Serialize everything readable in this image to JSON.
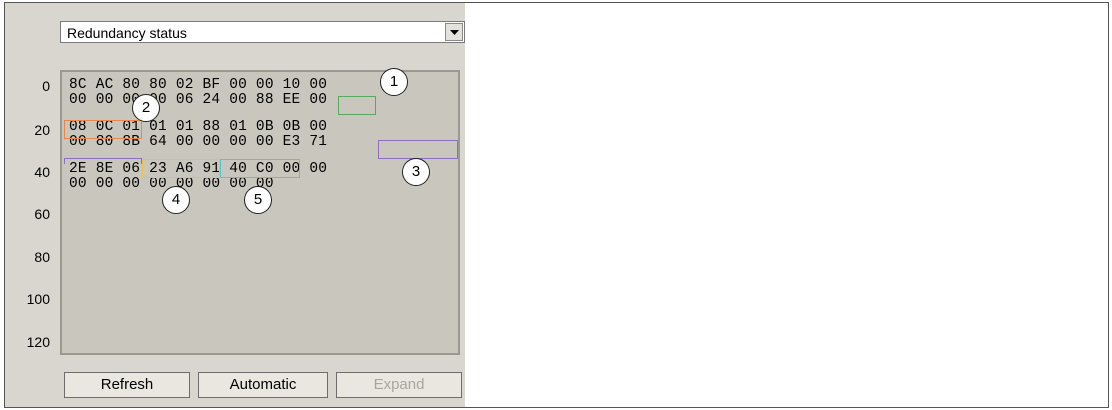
{
  "combo": {
    "selected": "Redundancy status"
  },
  "row_labels": [
    "0",
    "20",
    "40",
    "60",
    "80",
    "100",
    "120"
  ],
  "hex_lines": [
    "8C AC 80 80 02 BF 00 00 10 00",
    "00 00 00 00 06 24 00 88 EE 00",
    "08 0C 01 01 01 88 01 0B 0B 00",
    "00 80 8B 64 00 00 00 00 E3 71",
    "2E 8E 06 23 A6 91 40 C0 00 00",
    "00 00 00 00 00 00 00 00"
  ],
  "callouts": [
    "1",
    "2",
    "3",
    "4",
    "5"
  ],
  "buttons": {
    "refresh": "Refresh",
    "automatic": "Automatic",
    "expand": "Expand"
  },
  "colors": {
    "highlight_1": "#5aa860",
    "highlight_2": "#e8874a",
    "highlight_3": "#8e6ec0",
    "highlight_4": "#e8c24a",
    "highlight_5": "#5ec0d0"
  }
}
